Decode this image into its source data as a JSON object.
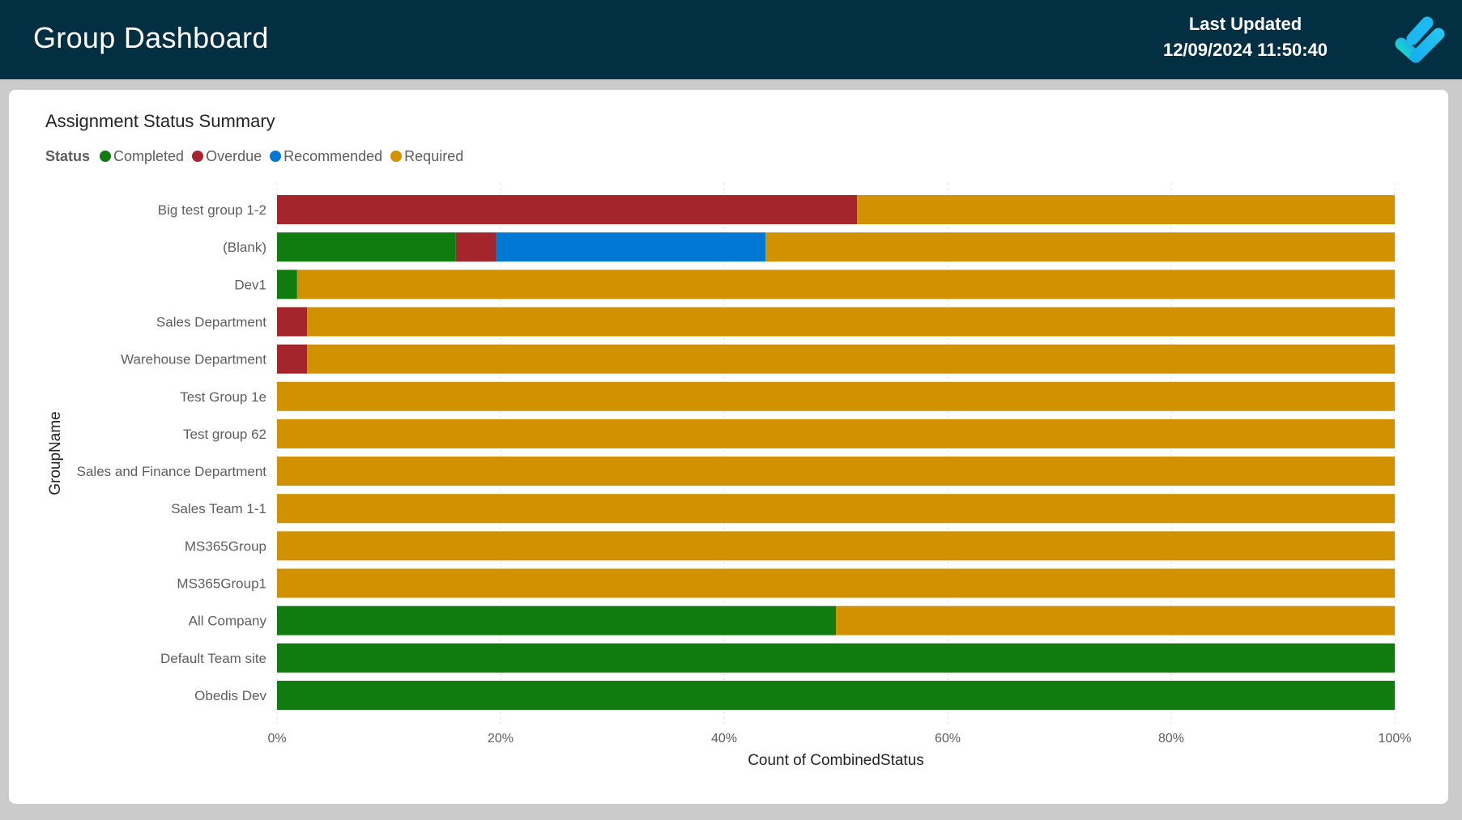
{
  "header": {
    "title": "Group Dashboard",
    "last_updated_label": "Last Updated",
    "last_updated_value": "12/09/2024 11:50:40",
    "logo_icon": "checkmark-logo-icon"
  },
  "legend": {
    "title": "Status",
    "items": [
      {
        "label": "Completed",
        "color": "#107c10"
      },
      {
        "label": "Overdue",
        "color": "#a4262c"
      },
      {
        "label": "Recommended",
        "color": "#0078d4"
      },
      {
        "label": "Required",
        "color": "#d29200"
      }
    ]
  },
  "chart_data": {
    "type": "bar",
    "orientation": "horizontal",
    "stacking": "100%",
    "title": "Assignment Status Summary",
    "xlabel": "Count of CombinedStatus",
    "ylabel": "GroupName",
    "xlim": [
      0,
      100
    ],
    "x_ticks": [
      "0%",
      "20%",
      "40%",
      "60%",
      "80%",
      "100%"
    ],
    "grid": true,
    "legend_position": "top-left",
    "categories": [
      "Big test group 1-2",
      "(Blank)",
      "Dev1",
      "Sales Department",
      "Warehouse Department",
      "Test Group 1e",
      "Test group 62",
      "Sales and Finance Department",
      "Sales Team 1-1",
      "MS365Group",
      "MS365Group1",
      "All Company",
      "Default Team site",
      "Obedis Dev"
    ],
    "series": [
      {
        "name": "Completed",
        "color": "#107c10",
        "values": [
          0,
          16.0,
          1.8,
          0,
          0,
          0,
          0,
          0,
          0,
          0,
          0,
          50.0,
          100,
          100
        ]
      },
      {
        "name": "Overdue",
        "color": "#a4262c",
        "values": [
          51.9,
          3.6,
          0,
          2.7,
          2.7,
          0,
          0,
          0,
          0,
          0,
          0,
          0,
          0,
          0
        ]
      },
      {
        "name": "Recommended",
        "color": "#0078d4",
        "values": [
          0,
          24.1,
          0,
          0,
          0,
          0,
          0,
          0,
          0,
          0,
          0,
          0,
          0,
          0
        ]
      },
      {
        "name": "Required",
        "color": "#d29200",
        "values": [
          48.1,
          56.3,
          98.2,
          97.3,
          97.3,
          100,
          100,
          100,
          100,
          100,
          100,
          50.0,
          0,
          0
        ]
      }
    ]
  }
}
